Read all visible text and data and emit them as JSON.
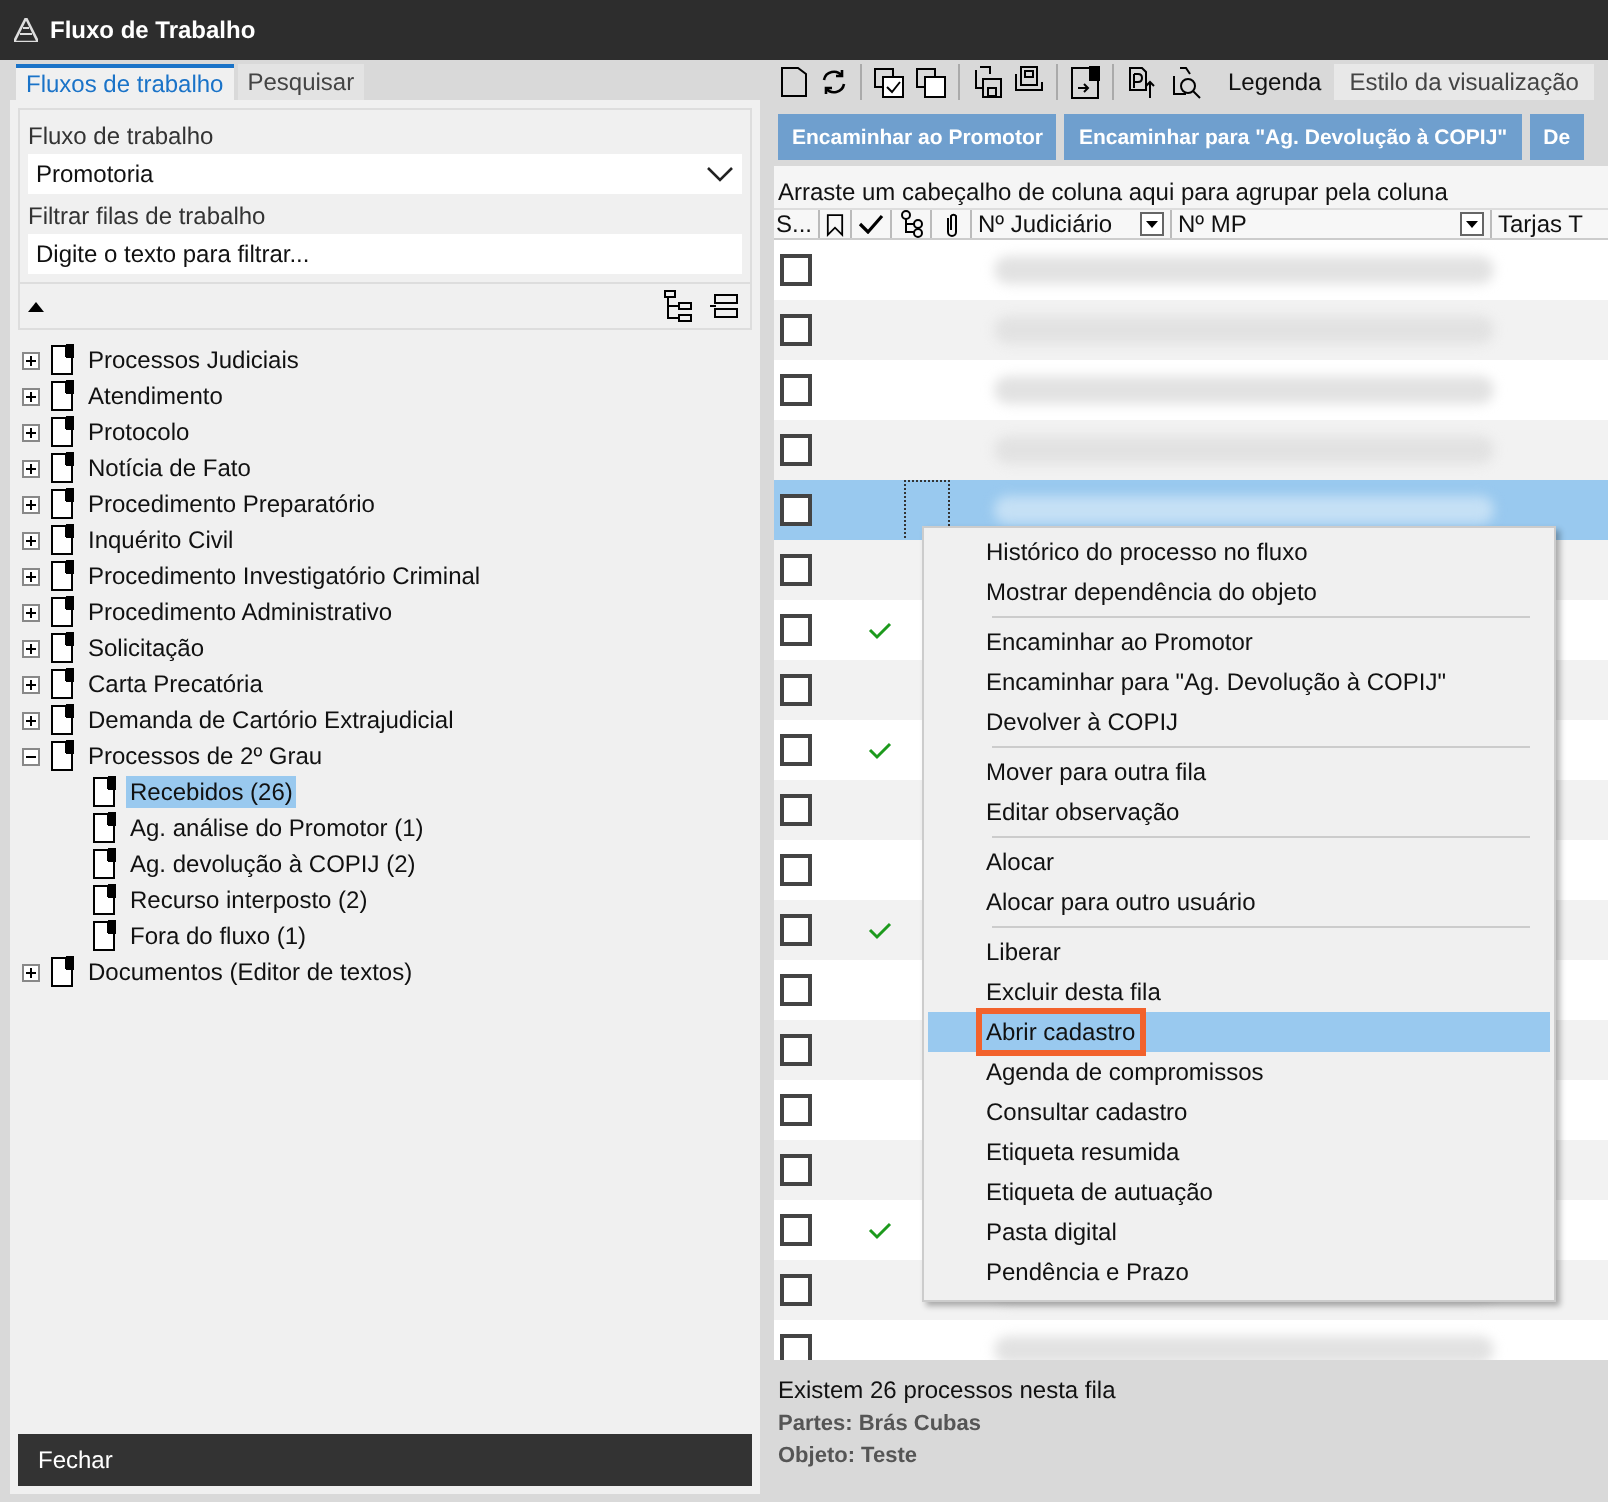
{
  "window": {
    "title": "Fluxo de Trabalho"
  },
  "left_tabs": [
    {
      "label": "Fluxos de trabalho",
      "selected": true
    },
    {
      "label": "Pesquisar",
      "selected": false
    }
  ],
  "workflow": {
    "label": "Fluxo de trabalho",
    "value": "Promotoria"
  },
  "filter": {
    "label": "Filtrar filas de trabalho",
    "placeholder": "Digite o texto para filtrar..."
  },
  "tree": [
    {
      "label": "Processos Judiciais",
      "expanded": false,
      "selected": false
    },
    {
      "label": "Atendimento",
      "expanded": false,
      "selected": false
    },
    {
      "label": "Protocolo",
      "expanded": false,
      "selected": false
    },
    {
      "label": "Notícia de Fato",
      "expanded": false,
      "selected": false
    },
    {
      "label": "Procedimento Preparatório",
      "expanded": false,
      "selected": false
    },
    {
      "label": "Inquérito Civil",
      "expanded": false,
      "selected": false
    },
    {
      "label": "Procedimento Investigatório Criminal",
      "expanded": false,
      "selected": false
    },
    {
      "label": "Procedimento Administrativo",
      "expanded": false,
      "selected": false
    },
    {
      "label": "Solicitação",
      "expanded": false,
      "selected": false
    },
    {
      "label": "Carta Precatória",
      "expanded": false,
      "selected": false
    },
    {
      "label": "Demanda de Cartório Extrajudicial",
      "expanded": false,
      "selected": false
    },
    {
      "label": "Processos de 2º Grau",
      "expanded": true,
      "selected": false,
      "children": [
        {
          "label": "Recebidos (26)",
          "selected": true
        },
        {
          "label": "Ag. análise do Promotor (1)",
          "selected": false
        },
        {
          "label": "Ag. devolução à COPIJ (2)",
          "selected": false
        },
        {
          "label": "Recurso interposto (2)",
          "selected": false
        },
        {
          "label": "Fora do fluxo (1)",
          "selected": false
        }
      ]
    },
    {
      "label": "Documentos (Editor de textos)",
      "expanded": false,
      "selected": false
    }
  ],
  "close_button": "Fechar",
  "toolbar": {
    "legend": "Legenda",
    "view_style": "Estilo da visualização"
  },
  "action_buttons": [
    "Encaminhar ao Promotor",
    "Encaminhar para \"Ag. Devolução à COPIJ\"",
    "De"
  ],
  "group_panel": "Arraste um cabeçalho de coluna aqui para agrupar pela coluna",
  "columns": [
    {
      "kind": "text",
      "label": "S..."
    },
    {
      "kind": "bookmark"
    },
    {
      "kind": "check"
    },
    {
      "kind": "tree"
    },
    {
      "kind": "clip"
    },
    {
      "kind": "filter",
      "label": "Nº Judiciário"
    },
    {
      "kind": "filter",
      "label": "Nº MP"
    },
    {
      "kind": "text",
      "label": "Tarjas T"
    }
  ],
  "rows": [
    {
      "checked": false,
      "done": false,
      "selected": false
    },
    {
      "checked": false,
      "done": false,
      "selected": false
    },
    {
      "checked": false,
      "done": false,
      "selected": false
    },
    {
      "checked": false,
      "done": false,
      "selected": false
    },
    {
      "checked": false,
      "done": false,
      "selected": true
    },
    {
      "checked": false,
      "done": false,
      "selected": false
    },
    {
      "checked": false,
      "done": true,
      "selected": false
    },
    {
      "checked": false,
      "done": false,
      "selected": false
    },
    {
      "checked": false,
      "done": true,
      "selected": false
    },
    {
      "checked": false,
      "done": false,
      "selected": false
    },
    {
      "checked": false,
      "done": false,
      "selected": false
    },
    {
      "checked": false,
      "done": true,
      "selected": false
    },
    {
      "checked": false,
      "done": false,
      "selected": false
    },
    {
      "checked": false,
      "done": false,
      "selected": false
    },
    {
      "checked": false,
      "done": false,
      "selected": false
    },
    {
      "checked": false,
      "done": false,
      "selected": false
    },
    {
      "checked": false,
      "done": true,
      "selected": false
    },
    {
      "checked": false,
      "done": false,
      "selected": false
    },
    {
      "checked": false,
      "done": false,
      "selected": false
    }
  ],
  "context_menu": [
    [
      {
        "label": "Histórico do processo no fluxo",
        "selected": false
      },
      {
        "label": "Mostrar dependência do objeto",
        "selected": false
      }
    ],
    [
      {
        "label": "Encaminhar ao Promotor",
        "selected": false
      },
      {
        "label": "Encaminhar para \"Ag. Devolução à COPIJ\"",
        "selected": false
      },
      {
        "label": "Devolver à COPIJ",
        "selected": false
      }
    ],
    [
      {
        "label": "Mover para outra fila",
        "selected": false
      },
      {
        "label": "Editar observação",
        "selected": false
      }
    ],
    [
      {
        "label": "Alocar",
        "selected": false
      },
      {
        "label": "Alocar para outro usuário",
        "selected": false
      }
    ],
    [
      {
        "label": "Liberar",
        "selected": false
      },
      {
        "label": "Excluir desta fila",
        "selected": false
      },
      {
        "label": "Abrir cadastro",
        "selected": true
      },
      {
        "label": "Agenda de compromissos",
        "selected": false
      },
      {
        "label": "Consultar cadastro",
        "selected": false
      },
      {
        "label": "Etiqueta resumida",
        "selected": false
      },
      {
        "label": "Etiqueta de autuação",
        "selected": false
      },
      {
        "label": "Pasta digital",
        "selected": false
      },
      {
        "label": "Pendência e Prazo",
        "selected": false
      }
    ]
  ],
  "status": {
    "count": "Existem 26 processos nesta fila",
    "parties": "Partes: Brás Cubas",
    "object": "Objeto: Teste"
  }
}
